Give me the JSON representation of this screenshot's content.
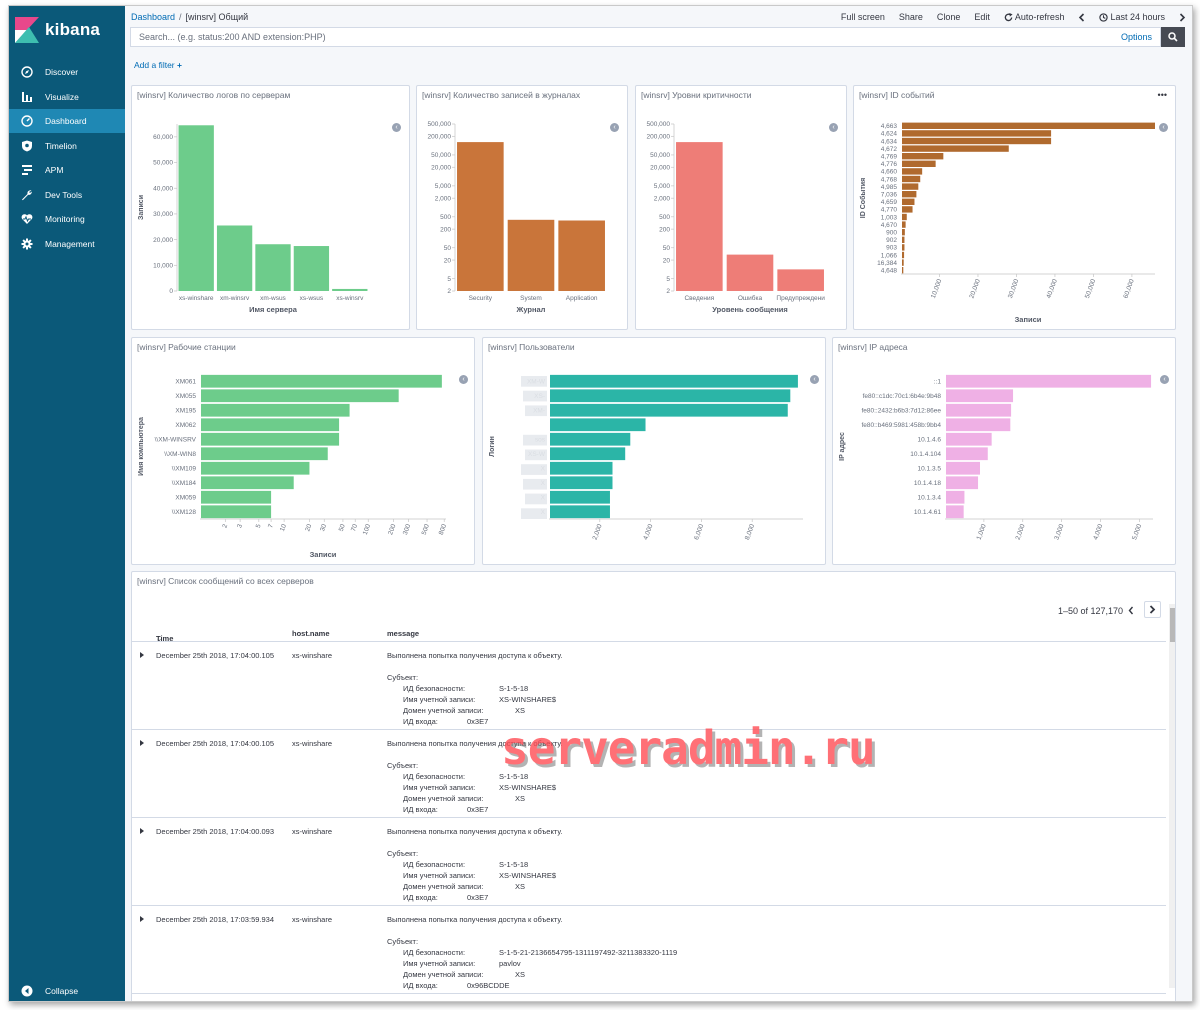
{
  "app": {
    "name": "kibana",
    "brand_colors": {
      "sidebar": "#0b5979",
      "active": "#1f88b4",
      "link": "#006bb4"
    }
  },
  "sidebar": {
    "items": [
      {
        "label": "Discover",
        "icon": "compass-icon"
      },
      {
        "label": "Visualize",
        "icon": "bar-chart-icon"
      },
      {
        "label": "Dashboard",
        "icon": "dashboard-icon",
        "active": true
      },
      {
        "label": "Timelion",
        "icon": "shield-icon"
      },
      {
        "label": "APM",
        "icon": "apm-icon"
      },
      {
        "label": "Dev Tools",
        "icon": "wrench-icon"
      },
      {
        "label": "Monitoring",
        "icon": "heartbeat-icon"
      },
      {
        "label": "Management",
        "icon": "gear-icon"
      }
    ],
    "collapse_label": "Collapse"
  },
  "breadcrumb": {
    "root": "Dashboard",
    "separator": "/",
    "current": "[winsrv] Общий"
  },
  "top_menu": {
    "full_screen": "Full screen",
    "share": "Share",
    "clone": "Clone",
    "edit": "Edit",
    "auto_refresh": "Auto-refresh",
    "time_range": "Last 24 hours"
  },
  "search": {
    "placeholder": "Search... (e.g. status:200 AND extension:PHP)",
    "value": "",
    "options_label": "Options"
  },
  "add_filter_label": "Add a filter",
  "panels": {
    "logs_by_server": {
      "title": "[winsrv] Количество логов по серверам"
    },
    "records_in_logs": {
      "title": "[winsrv] Количество записей в журналах"
    },
    "severity": {
      "title": "[winsrv] Уровни критичности"
    },
    "event_ids": {
      "title": "[winsrv] ID событий"
    },
    "workstations": {
      "title": "[winsrv] Рабочие станции"
    },
    "users": {
      "title": "[winsrv] Пользователи"
    },
    "ip": {
      "title": "[winsrv] IP адреса"
    },
    "messages": {
      "title": "[winsrv] Список сообщений со всех серверов"
    }
  },
  "chart_data": [
    {
      "id": "logs_by_server",
      "type": "bar",
      "categories": [
        "xs-winshare",
        "xm-winsrv",
        "xm-wsus",
        "xs-wsus",
        "xs-winsrv"
      ],
      "values": [
        64500,
        25500,
        18200,
        17500,
        800
      ],
      "xlabel": "Имя сервера",
      "ylabel": "Записи",
      "yticks": [
        "0",
        "10,000",
        "20,000",
        "30,000",
        "40,000",
        "50,000",
        "60,000"
      ],
      "ylim": [
        0,
        65000
      ],
      "color": "#6dcc8b"
    },
    {
      "id": "records_in_logs",
      "type": "bar",
      "scale": "log",
      "categories": [
        "Security",
        "System",
        "Application"
      ],
      "values": [
        130000,
        400,
        380
      ],
      "xlabel": "Журнал",
      "yticks": [
        "2",
        "5",
        "20",
        "50",
        "200",
        "500",
        "2,000",
        "5,000",
        "20,000",
        "50,000",
        "200,000",
        "500,000"
      ],
      "color": "#c9753a"
    },
    {
      "id": "severity",
      "type": "bar",
      "scale": "log",
      "categories": [
        "Сведения",
        "Ошибка",
        "Предупреждени"
      ],
      "values": [
        130000,
        30,
        10
      ],
      "xlabel": "Уровень сообщения",
      "yticks": [
        "2",
        "5",
        "20",
        "50",
        "200",
        "500",
        "2,000",
        "5,000",
        "20,000",
        "50,000",
        "200,000",
        "500,000"
      ],
      "color": "#ee7d77"
    },
    {
      "id": "event_ids",
      "type": "bar",
      "orientation": "horizontal",
      "categories": [
        "4,663",
        "4,624",
        "4,634",
        "4,672",
        "4,769",
        "4,776",
        "4,660",
        "4,768",
        "4,985",
        "7,036",
        "4,659",
        "4,770",
        "1,003",
        "4,670",
        "900",
        "902",
        "903",
        "1,066",
        "16,384",
        "4,648"
      ],
      "values": [
        66000,
        39000,
        39000,
        28000,
        11000,
        9000,
        5500,
        5000,
        4500,
        4000,
        3500,
        3000,
        1500,
        1200,
        1000,
        900,
        900,
        800,
        700,
        600
      ],
      "xlabel": "Записи",
      "ylabel": "ID События",
      "xticks": [
        "10,000",
        "20,000",
        "30,000",
        "40,000",
        "50,000",
        "60,000"
      ],
      "xlim": [
        0,
        66000
      ],
      "color": "#b06a2e"
    },
    {
      "id": "workstations",
      "type": "bar",
      "orientation": "horizontal",
      "scale": "log",
      "categories": [
        "XM061",
        "XM055",
        "XM195",
        "XM062",
        "\\\\XM-WINSRV",
        "\\\\XM-WIN8",
        "\\\\XM109",
        "\\\\XM184",
        "XM059",
        "\\\\XM128"
      ],
      "values": [
        750,
        230,
        60,
        45,
        45,
        33,
        20,
        13,
        7,
        7
      ],
      "xlabel": "Записи",
      "ylabel": "Имя компьютера",
      "xticks": [
        "2",
        "3",
        "5",
        "7",
        "10",
        "20",
        "30",
        "50",
        "70",
        "100",
        "200",
        "300",
        "500",
        "800"
      ],
      "color": "#6dcc8b"
    },
    {
      "id": "users",
      "type": "bar",
      "orientation": "horizontal",
      "categories": [
        "XM-W",
        "XS-",
        "XM-",
        "",
        "sos",
        "XS-W",
        "X",
        "X",
        "X",
        "X"
      ],
      "values": [
        9800,
        9500,
        9400,
        3800,
        3200,
        3000,
        2500,
        2500,
        2400,
        2400
      ],
      "ylabel": "Логин",
      "xticks": [
        "2,000",
        "4,000",
        "6,000",
        "8,000"
      ],
      "xlim": [
        0,
        10000
      ],
      "color": "#2bb5a7"
    },
    {
      "id": "ip",
      "type": "bar",
      "orientation": "horizontal",
      "categories": [
        "::1",
        "fe80::c1dc:70c1:6b4e:9b48",
        "fe80::2432:b6b3:7d12:86ee",
        "fe80::b469:5981:458b:9bb4",
        "10.1.4.6",
        "10.1.4.104",
        "10.1.3.5",
        "10.1.4.18",
        "10.1.3.4",
        "10.1.4.61"
      ],
      "values": [
        5300,
        1750,
        1700,
        1680,
        1200,
        1100,
        900,
        850,
        500,
        480
      ],
      "ylabel": "IP адрес",
      "xticks": [
        "1,000",
        "2,000",
        "3,000",
        "4,000",
        "5,000"
      ],
      "xlim": [
        0,
        5350
      ],
      "color": "#efb0e5"
    }
  ],
  "table": {
    "pagination": "1–50 of 127,170",
    "columns": [
      "Time",
      "host.name",
      "message"
    ],
    "rows": [
      {
        "time": "December 25th 2018, 17:04:00.105",
        "host": "xs-winshare",
        "msg1": "Выполнена попытка получения доступа к объекту.",
        "msg2": "Субъект:",
        "fields": [
          {
            "k": "ИД безопасности:",
            "v": "S-1-5-18"
          },
          {
            "k": "Имя учетной записи:",
            "v": "XS-WINSHARE$"
          },
          {
            "k": "Домен учетной записи:",
            "v": "XS"
          },
          {
            "k": "ИД входа:",
            "v": "0x3E7"
          }
        ]
      },
      {
        "time": "December 25th 2018, 17:04:00.105",
        "host": "xs-winshare",
        "msg1": "Выполнена попытка получения доступа к объекту.",
        "msg2": "Субъект:",
        "fields": [
          {
            "k": "ИД безопасности:",
            "v": "S-1-5-18"
          },
          {
            "k": "Имя учетной записи:",
            "v": "XS-WINSHARE$"
          },
          {
            "k": "Домен учетной записи:",
            "v": "XS"
          },
          {
            "k": "ИД входа:",
            "v": "0x3E7"
          }
        ]
      },
      {
        "time": "December 25th 2018, 17:04:00.093",
        "host": "xs-winshare",
        "msg1": "Выполнена попытка получения доступа к объекту.",
        "msg2": "Субъект:",
        "fields": [
          {
            "k": "ИД безопасности:",
            "v": "S-1-5-18"
          },
          {
            "k": "Имя учетной записи:",
            "v": "XS-WINSHARE$"
          },
          {
            "k": "Домен учетной записи:",
            "v": "XS"
          },
          {
            "k": "ИД входа:",
            "v": "0x3E7"
          }
        ]
      },
      {
        "time": "December 25th 2018, 17:03:59.934",
        "host": "xs-winshare",
        "msg1": "Выполнена попытка получения доступа к объекту.",
        "msg2": "Субъект:",
        "fields": [
          {
            "k": "ИД безопасности:",
            "v": "S-1-5-21-2136654795-1311197492-3211383320-1119"
          },
          {
            "k": "Имя учетной записи:",
            "v": "pavlov"
          },
          {
            "k": "Домен учетной записи:",
            "v": "XS"
          },
          {
            "k": "ИД входа:",
            "v": "0x96BCDDE"
          }
        ]
      }
    ]
  },
  "watermark": "serveradmin.ru"
}
